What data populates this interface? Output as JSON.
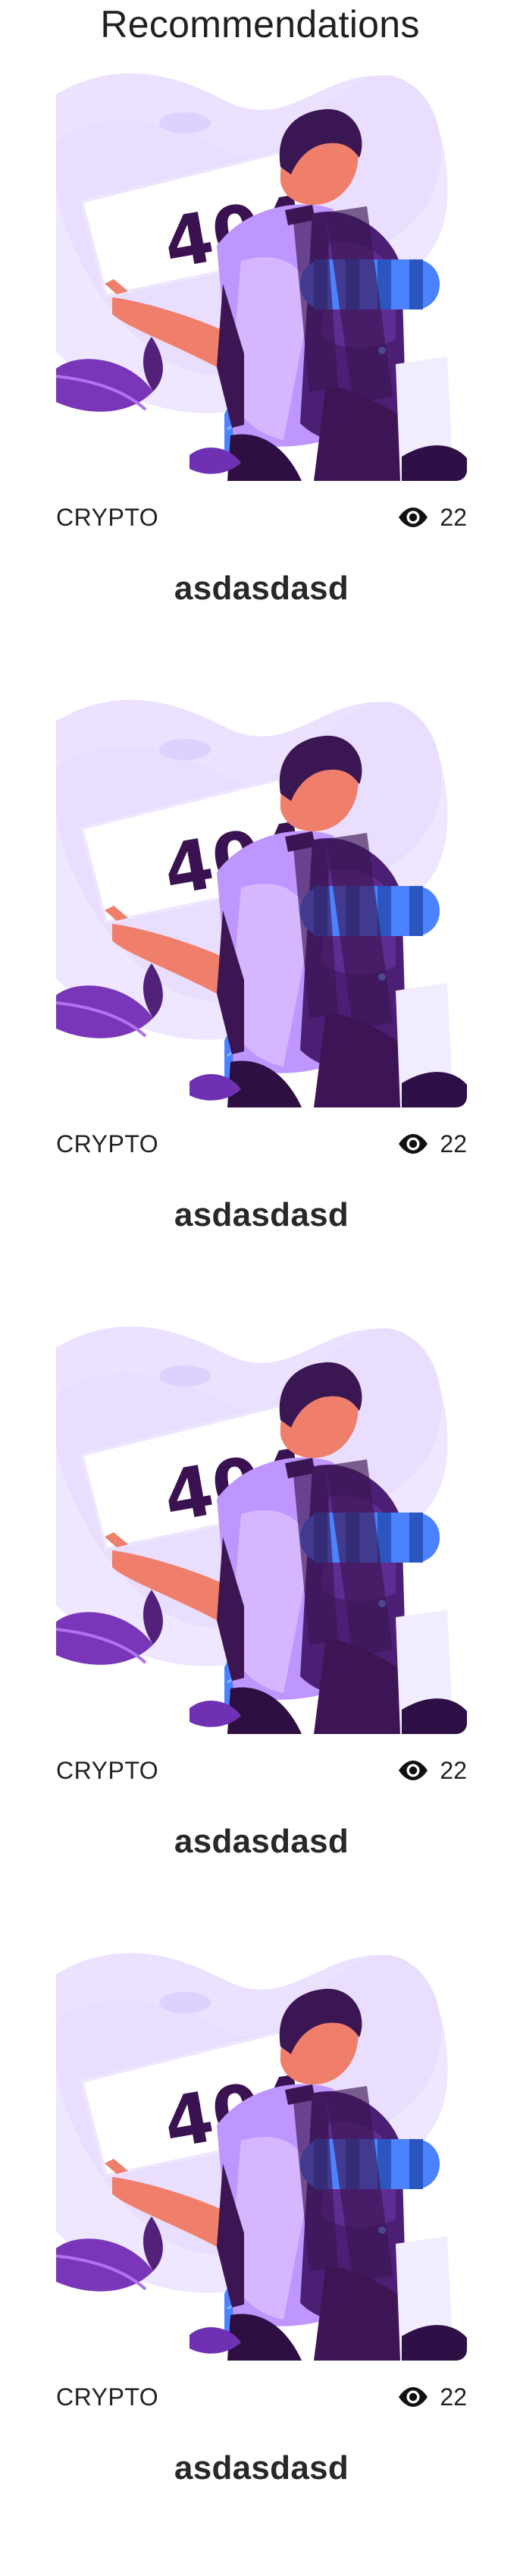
{
  "page": {
    "title": "Recommendations"
  },
  "recommendations": [
    {
      "category": "CRYPTO",
      "views": "22",
      "title": "asdasdasd",
      "image_text": "404",
      "icon": "eye-icon"
    },
    {
      "category": "CRYPTO",
      "views": "22",
      "title": "asdasdasd",
      "image_text": "404",
      "icon": "eye-icon"
    },
    {
      "category": "CRYPTO",
      "views": "22",
      "title": "asdasdasd",
      "image_text": "404",
      "icon": "eye-icon"
    },
    {
      "category": "CRYPTO",
      "views": "22",
      "title": "asdasdasd",
      "image_text": "404",
      "icon": "eye-icon"
    }
  ],
  "colors": {
    "text": "#1f1f1f",
    "purple_dark": "#3f1260",
    "purple_light": "#d7c6ff",
    "blue": "#4b82ff",
    "skin": "#ef7f6a"
  }
}
